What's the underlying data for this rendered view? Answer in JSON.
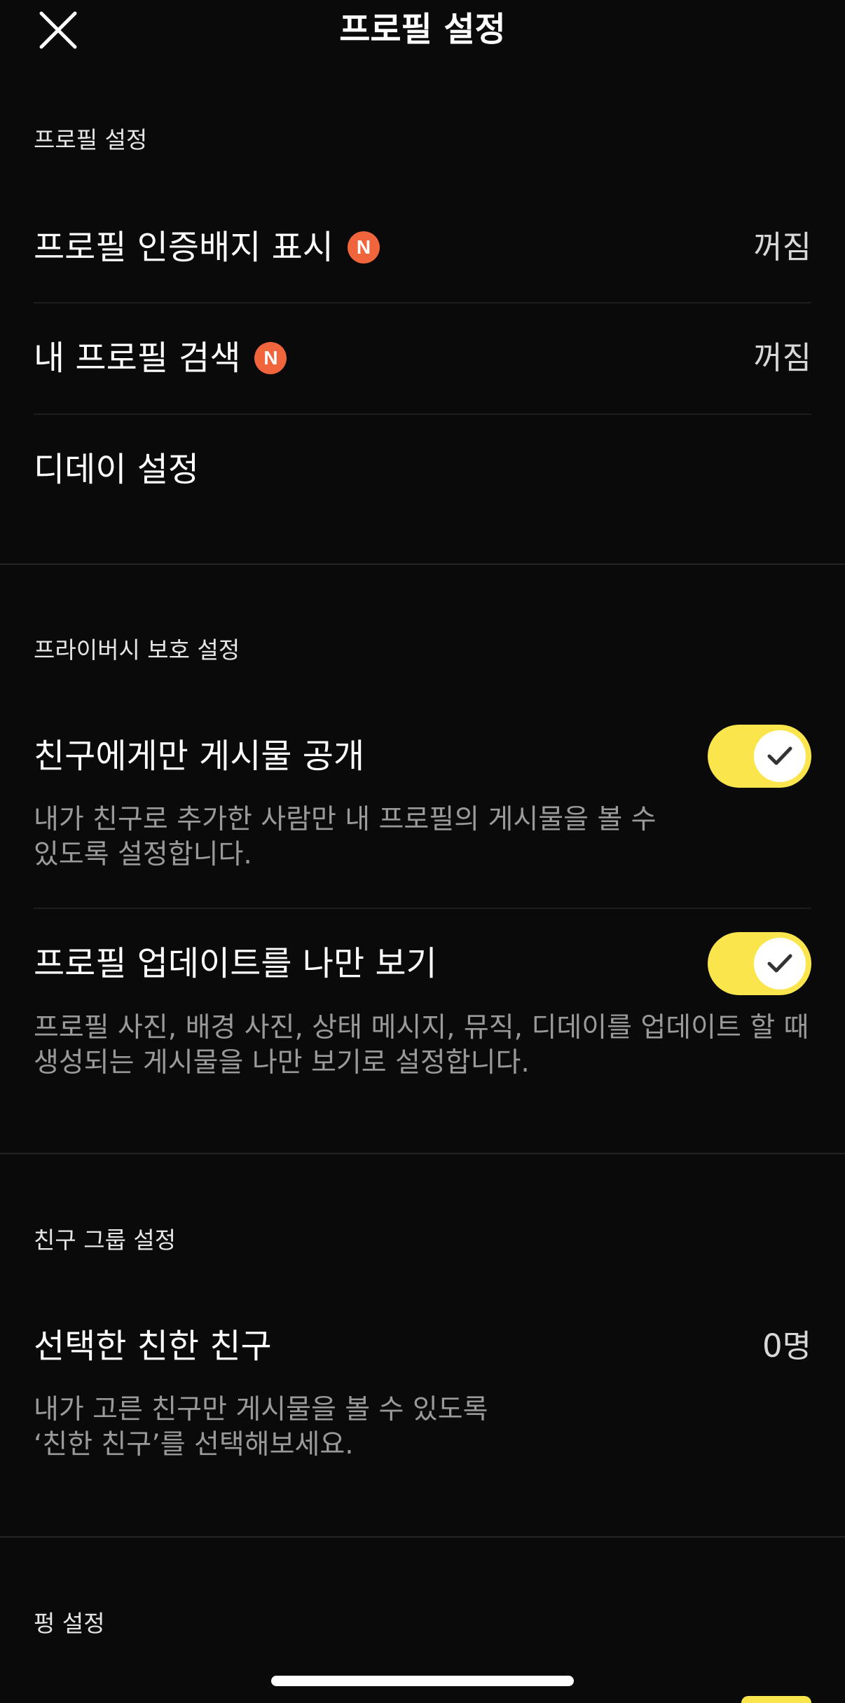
{
  "header": {
    "title": "프로필 설정",
    "close_icon": "close-icon"
  },
  "sections": {
    "profile": {
      "label": "프로필 설정",
      "items": [
        {
          "label": "프로필 인증배지 표시",
          "badge": "N",
          "value": "꺼짐"
        },
        {
          "label": "내 프로필 검색",
          "badge": "N",
          "value": "꺼짐"
        },
        {
          "label": "디데이 설정"
        }
      ]
    },
    "privacy": {
      "label": "프라이버시 보호 설정",
      "items": [
        {
          "label": "친구에게만 게시물 공개",
          "enabled": true,
          "desc_line1": "내가 친구로 추가한 사람만 내 프로필의 게시물을 볼 수",
          "desc_line2": "있도록 설정합니다."
        },
        {
          "label": "프로필 업데이트를 나만 보기",
          "enabled": true,
          "desc_line1": "프로필 사진, 배경 사진, 상태 메시지, 뮤직, 디데이를 업데이트 할 때",
          "desc_line2": "생성되는 게시물을 나만 보기로 설정합니다."
        }
      ]
    },
    "friend_group": {
      "label": "친구 그룹 설정",
      "items": [
        {
          "label": "선택한 친한 친구",
          "value": "0명",
          "desc_line1": "내가 고른 친구만 게시물을 볼 수 있도록",
          "desc_line2": "‘친한 친구’를 선택해보세요."
        }
      ]
    },
    "pung": {
      "label": "펑 설정"
    }
  },
  "colors": {
    "background": "#0a0a0a",
    "toggle_on": "#fbe54d",
    "new_badge": "#f0653b",
    "secondary_text": "#9a9a9a"
  }
}
